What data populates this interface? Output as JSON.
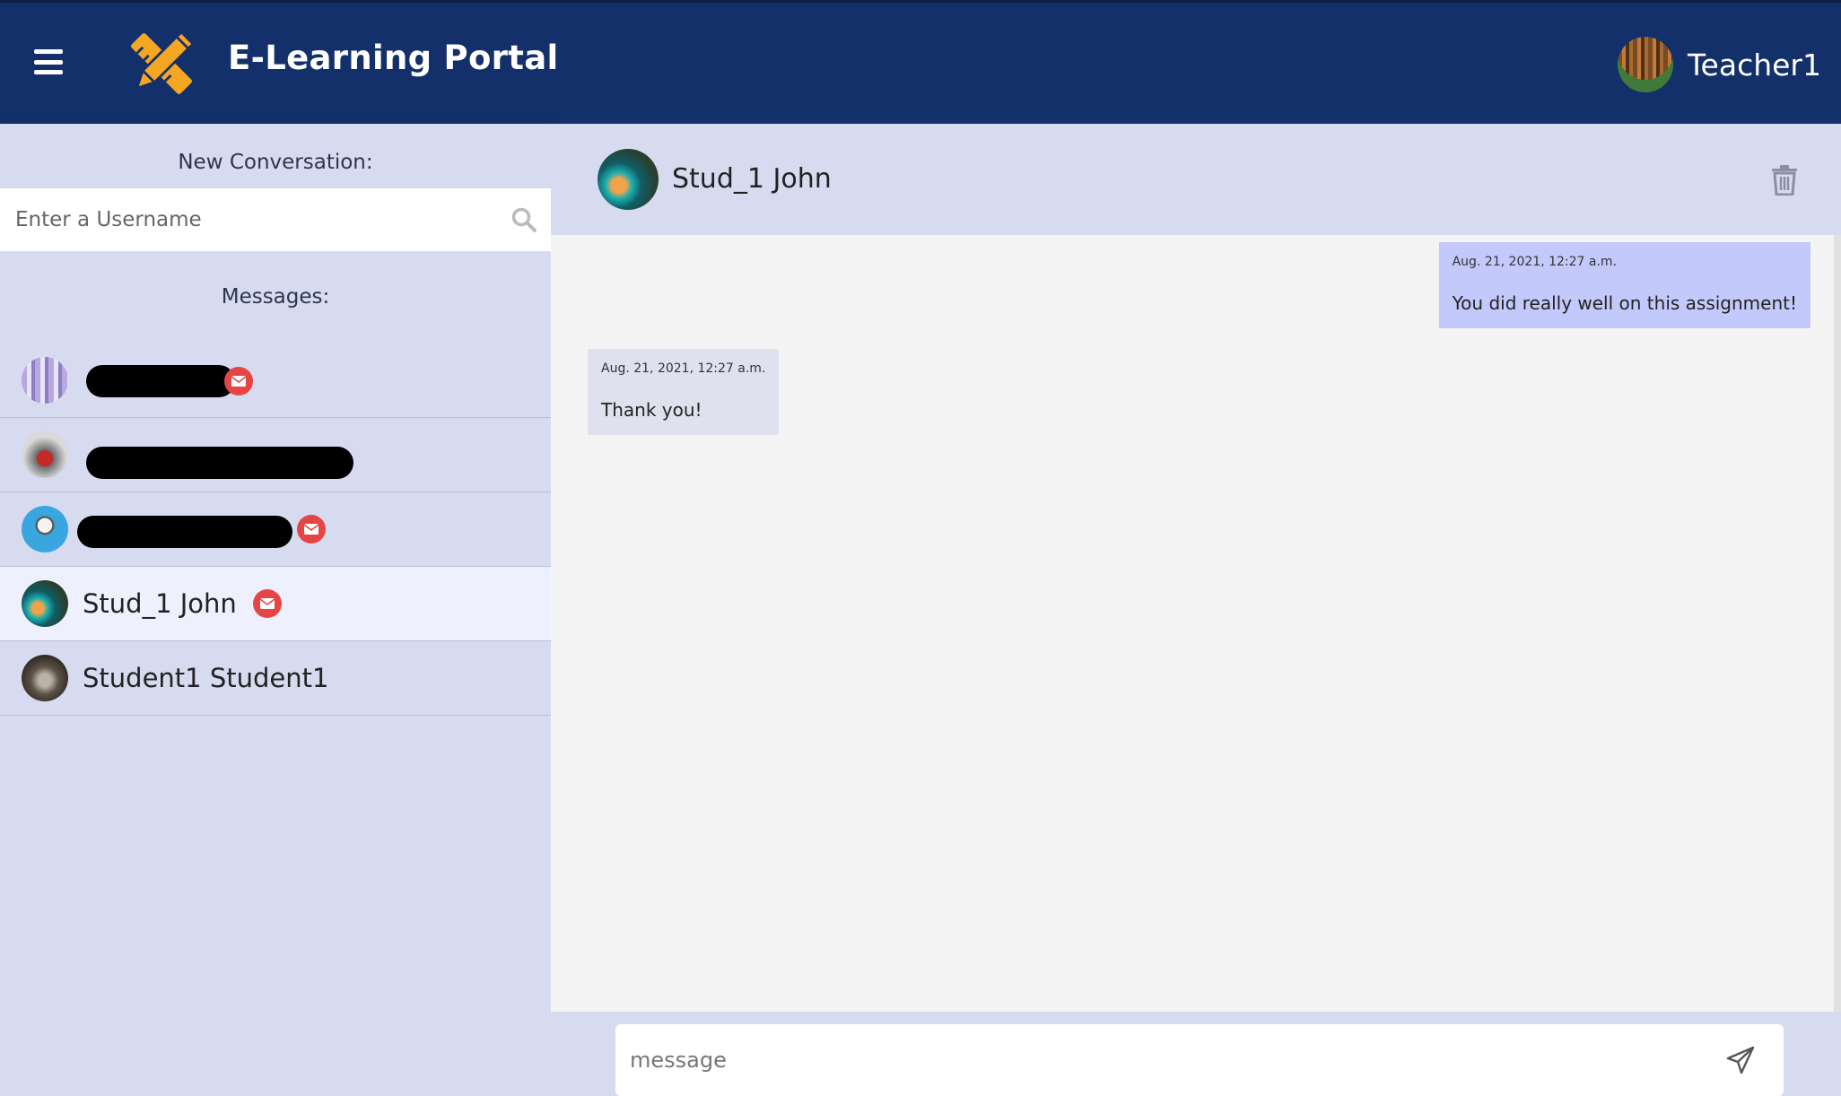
{
  "app": {
    "title": "E-Learning Portal",
    "user_name": "Teacher1",
    "brand_color": "#13306a",
    "logo_color": "#f5a623",
    "icons": {
      "menu": "hamburger-icon",
      "logo": "pencil-ruler-icon"
    }
  },
  "sidebar": {
    "new_conversation_label": "New Conversation:",
    "search_placeholder": "Enter a Username",
    "messages_label": "Messages:",
    "conversations": [
      {
        "name": "",
        "redacted": true,
        "unread": true
      },
      {
        "name": "",
        "redacted": true,
        "unread": false
      },
      {
        "name": "",
        "redacted": true,
        "unread": true
      },
      {
        "name": "Stud_1 John",
        "redacted": false,
        "unread": true,
        "active": true
      },
      {
        "name": "Student1 Student1",
        "redacted": false,
        "unread": false
      }
    ],
    "unread_color": "#e74545"
  },
  "chat": {
    "contact_name": "Stud_1 John",
    "messages": [
      {
        "direction": "outgoing",
        "time": "Aug. 21, 2021, 12:27 a.m.",
        "text": "You did really well on this assignment!"
      },
      {
        "direction": "incoming",
        "time": "Aug. 21, 2021, 12:27 a.m.",
        "text": "Thank you!"
      }
    ],
    "composer_placeholder": "message",
    "outgoing_color": "#c4c9fb",
    "incoming_color": "#dfe1ee"
  }
}
